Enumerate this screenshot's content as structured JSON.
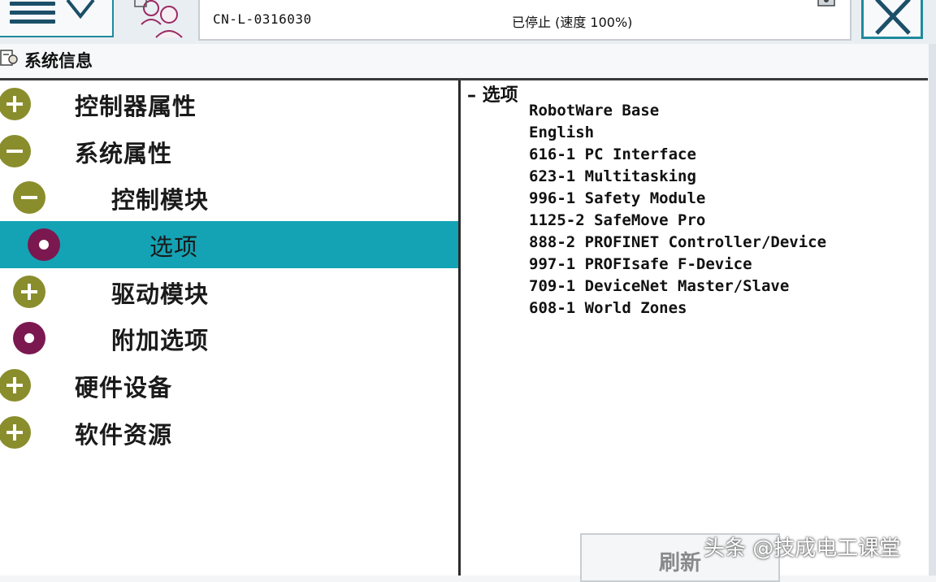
{
  "topbar": {
    "controller_name": "CN-L-0316030",
    "status": "已停止 (速度 100%)"
  },
  "page": {
    "title": "系统信息"
  },
  "tree": [
    {
      "label": "控制器属性",
      "icon": "plus-icon"
    },
    {
      "label": "系统属性",
      "icon": "minus-icon"
    },
    {
      "label": "控制模块",
      "icon": "minus-icon"
    },
    {
      "label": "选项",
      "icon": "dot-icon",
      "selected": true
    },
    {
      "label": "驱动模块",
      "icon": "plus-icon"
    },
    {
      "label": "附加选项",
      "icon": "dot-icon"
    },
    {
      "label": "硬件设备",
      "icon": "plus-icon"
    },
    {
      "label": "软件资源",
      "icon": "plus-icon"
    }
  ],
  "content": {
    "heading": "– 选项",
    "options": [
      "RobotWare Base",
      "English",
      "616-1 PC Interface",
      "623-1 Multitasking",
      "996-1 Safety Module",
      "1125-2 SafeMove Pro",
      "888-2 PROFINET Controller/Device",
      "997-1 PROFIsafe F-Device",
      "709-1 DeviceNet Master/Slave",
      "608-1 World Zones"
    ]
  },
  "buttons": {
    "refresh": "刷新"
  },
  "watermark": "头条 @技成电工课堂",
  "colors": {
    "accent": "#1f8a9c",
    "selection": "#14a3b4",
    "expand_icon": "#8a8d2c",
    "leaf_icon": "#7b1850"
  }
}
